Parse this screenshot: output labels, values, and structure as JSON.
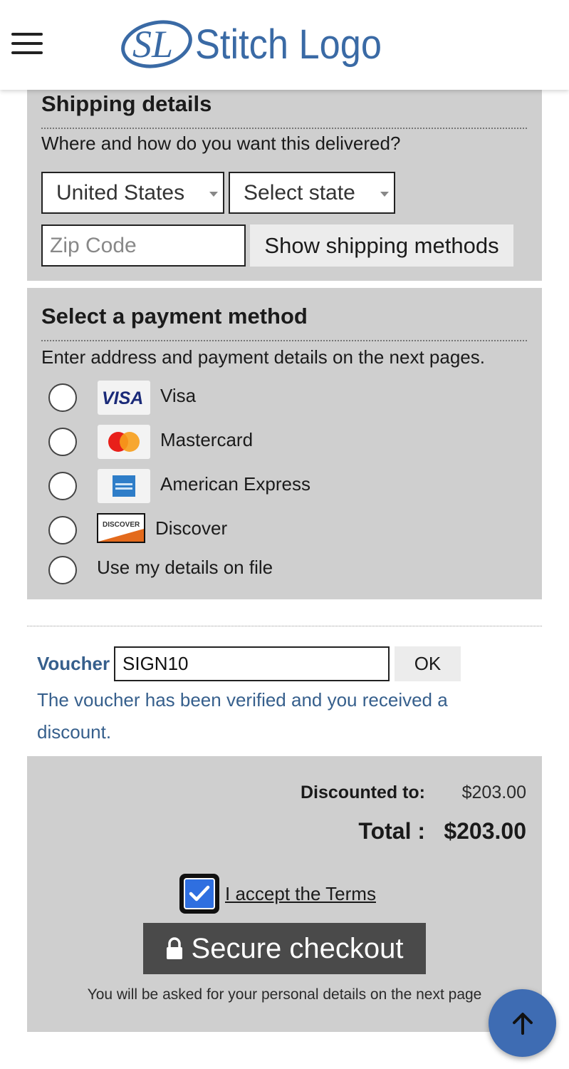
{
  "header": {
    "logo_monogram": "SL",
    "logo_text": "Stitch Logo"
  },
  "shipping": {
    "title": "Shipping details",
    "subtitle": "Where and how do you want this delivered?",
    "country_value": "United States",
    "state_value": "Select state",
    "zip_placeholder": "Zip Code",
    "show_methods_label": "Show shipping methods"
  },
  "payment": {
    "title": "Select a payment method",
    "subtitle": "Enter address and payment details on the next pages.",
    "options": [
      {
        "label": "Visa",
        "icon": "visa-logo-icon"
      },
      {
        "label": "Mastercard",
        "icon": "mastercard-logo-icon"
      },
      {
        "label": "American Express",
        "icon": "amex-logo-icon"
      },
      {
        "label": "Discover",
        "icon": "discover-logo-icon"
      },
      {
        "label": "Use my details on file",
        "icon": ""
      }
    ]
  },
  "voucher": {
    "label": "Voucher",
    "value": "SIGN10",
    "ok_label": "OK",
    "message": "The voucher has been verified and you received a discount."
  },
  "summary": {
    "discounted_label": "Discounted to:",
    "discounted_value": "$203.00",
    "total_label": "Total :",
    "total_value": "$203.00",
    "terms_label": "I accept the Terms",
    "terms_checked": true,
    "checkout_label": "Secure checkout",
    "note": "You will be asked for your personal details on the next page"
  },
  "colors": {
    "accent_blue": "#365f8c",
    "fab_blue": "#3e6cb3",
    "panel_gray": "#cfcfcf",
    "checkout_dark": "#4a4a4a"
  }
}
